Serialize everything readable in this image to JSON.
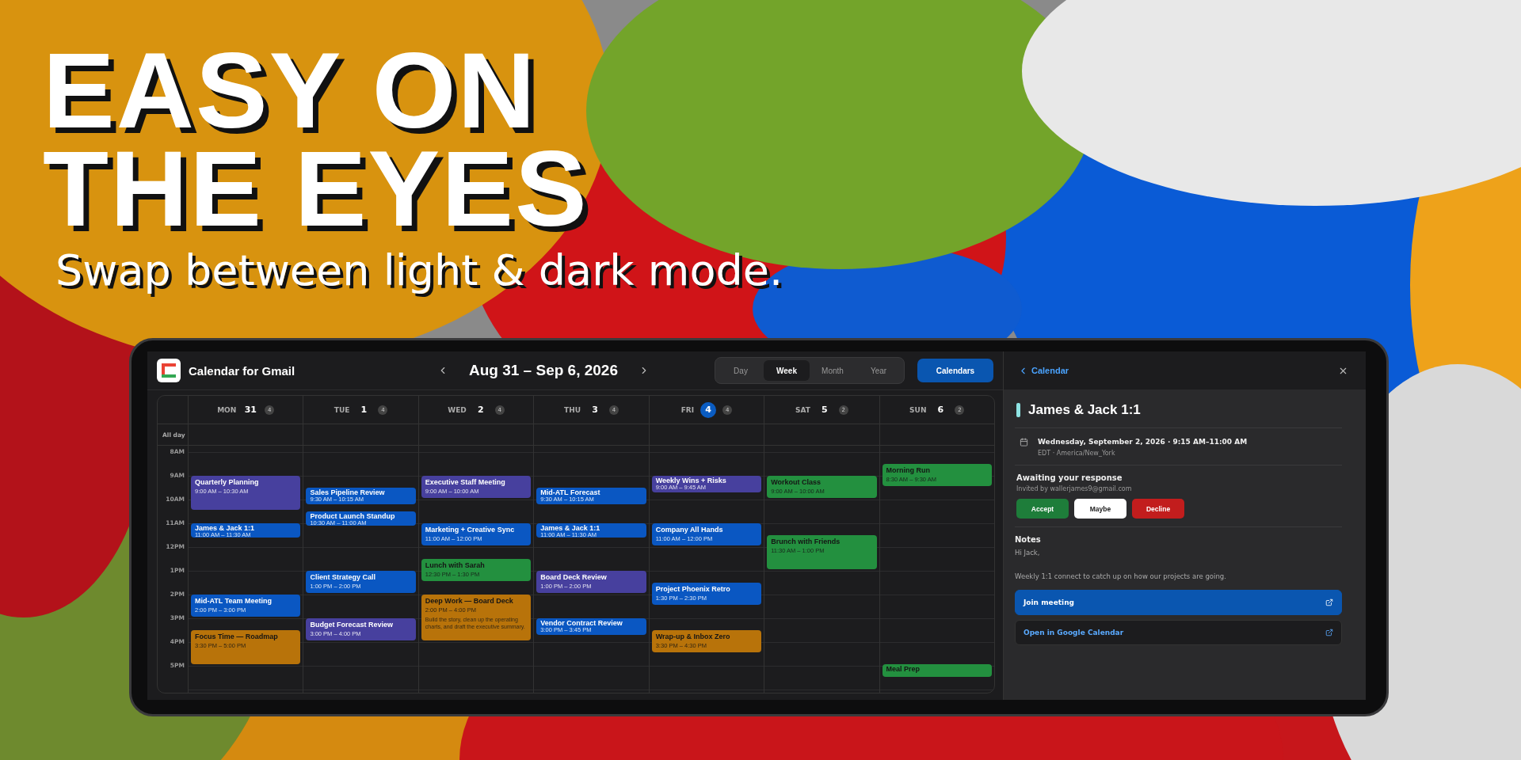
{
  "banner": {
    "headline": [
      "EASY ON",
      "THE EYES"
    ],
    "subtitle": "Swap between light & dark mode."
  },
  "app": {
    "title": "Calendar for Gmail",
    "range": "Aug 31 – Sep 6, 2026",
    "views": [
      {
        "label": "Day",
        "selected": false
      },
      {
        "label": "Week",
        "selected": true
      },
      {
        "label": "Month",
        "selected": false
      },
      {
        "label": "Year",
        "selected": false
      }
    ],
    "calendars_button": "Calendars",
    "all_day_label": "All day",
    "hours": [
      "8AM",
      "9AM",
      "10AM",
      "11AM",
      "12PM",
      "1PM",
      "2PM",
      "3PM",
      "4PM",
      "5PM"
    ],
    "days": [
      {
        "name": "MON",
        "date": "31",
        "count": "4",
        "today": false,
        "events": [
          {
            "title": "Quarterly Planning",
            "time": "9:00 AM – 10:30 AM",
            "color": "#47409e"
          },
          {
            "title": "James & Jack 1:1",
            "time": "11:00 AM – 11:30 AM",
            "color": "#0a57c2"
          },
          {
            "title": "Mid-ATL Team Meeting",
            "time": "2:00 PM – 3:00 PM",
            "color": "#0a57c2"
          },
          {
            "title": "Focus Time — Roadmap",
            "time": "3:30 PM – 5:00 PM",
            "color": "#b8730a"
          }
        ]
      },
      {
        "name": "TUE",
        "date": "1",
        "count": "4",
        "today": false,
        "events": [
          {
            "title": "Sales Pipeline Review",
            "time": "9:30 AM – 10:15 AM",
            "color": "#0a57c2"
          },
          {
            "title": "Product Launch Standup",
            "time": "10:30 AM – 11:00 AM",
            "color": "#0a57c2"
          },
          {
            "title": "Client Strategy Call",
            "time": "1:00 PM – 2:00 PM",
            "color": "#0a57c2"
          },
          {
            "title": "Budget Forecast Review",
            "time": "3:00 PM – 4:00 PM",
            "color": "#47409e"
          }
        ]
      },
      {
        "name": "WED",
        "date": "2",
        "count": "4",
        "today": false,
        "events": [
          {
            "title": "Executive Staff Meeting",
            "time": "9:00 AM – 10:00 AM",
            "color": "#47409e"
          },
          {
            "title": "Marketing + Creative Sync",
            "time": "11:00 AM – 12:00 PM",
            "color": "#0a57c2"
          },
          {
            "title": "Lunch with Sarah",
            "time": "12:30 PM – 1:30 PM",
            "color": "#23903f"
          },
          {
            "title": "Deep Work — Board Deck",
            "time": "2:00 PM – 4:00 PM",
            "color": "#b8730a",
            "description": "Build the story, clean up the operating charts, and draft the executive summary."
          }
        ]
      },
      {
        "name": "THU",
        "date": "3",
        "count": "4",
        "today": false,
        "events": [
          {
            "title": "Mid-ATL Forecast",
            "time": "9:30 AM – 10:15 AM",
            "color": "#0a57c2"
          },
          {
            "title": "James & Jack 1:1",
            "time": "11:00 AM – 11:30 AM",
            "color": "#0a57c2"
          },
          {
            "title": "Board Deck Review",
            "time": "1:00 PM – 2:00 PM",
            "color": "#47409e"
          },
          {
            "title": "Vendor Contract Review",
            "time": "3:00 PM – 3:45 PM",
            "color": "#0a57c2"
          }
        ]
      },
      {
        "name": "FRI",
        "date": "4",
        "count": "4",
        "today": true,
        "events": [
          {
            "title": "Weekly Wins + Risks",
            "time": "9:00 AM – 9:45 AM",
            "color": "#47409e"
          },
          {
            "title": "Company All Hands",
            "time": "11:00 AM – 12:00 PM",
            "color": "#0a57c2"
          },
          {
            "title": "Project Phoenix Retro",
            "time": "1:30 PM – 2:30 PM",
            "color": "#0a57c2"
          },
          {
            "title": "Wrap-up & Inbox Zero",
            "time": "3:30 PM – 4:30 PM",
            "color": "#b8730a"
          }
        ]
      },
      {
        "name": "SAT",
        "date": "5",
        "count": "2",
        "today": false,
        "events": [
          {
            "title": "Workout Class",
            "time": "9:00 AM – 10:00 AM",
            "color": "#23903f"
          },
          {
            "title": "Brunch with Friends",
            "time": "11:30 AM – 1:00 PM",
            "color": "#23903f"
          }
        ]
      },
      {
        "name": "SUN",
        "date": "6",
        "count": "2",
        "today": false,
        "events": [
          {
            "title": "Morning Run",
            "time": "8:30 AM – 9:30 AM",
            "color": "#23903f"
          },
          {
            "title": "Meal Prep",
            "color": "#23903f"
          }
        ]
      }
    ]
  },
  "detail": {
    "back": "Calendar",
    "title": "James & Jack 1:1",
    "when": "Wednesday, September 2, 2026 · 9:15 AM–11:00 AM",
    "timezone": "EDT · America/New_York",
    "rsvp_heading": "Awaiting your response",
    "invited_by": "Invited by wallerjames9@gmail.com",
    "responses": [
      {
        "label": "Accept",
        "kind": "accept"
      },
      {
        "label": "Maybe",
        "kind": "maybe"
      },
      {
        "label": "Decline",
        "kind": "decline"
      }
    ],
    "notes_heading": "Notes",
    "notes": [
      "Hi Jack,",
      "Weekly 1:1 connect to catch up on how our projects are going."
    ],
    "links": [
      {
        "label": "Join meeting",
        "kind": "primary"
      },
      {
        "label": "Open in Google Calendar",
        "kind": "secondary"
      }
    ]
  }
}
